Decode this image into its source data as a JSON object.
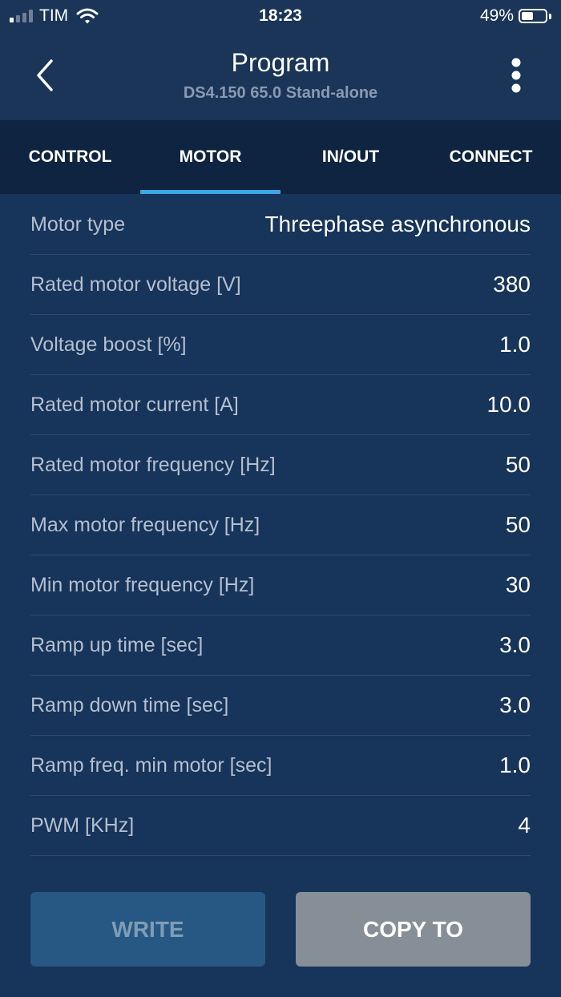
{
  "status_bar": {
    "carrier": "TIM",
    "time": "18:23",
    "battery": "49%",
    "battery_level": 0.49,
    "signal_bars_active": 1,
    "signal_bars_total": 4
  },
  "header": {
    "title": "Program",
    "subtitle": "DS4.150 65.0 Stand-alone",
    "back_icon": "chevron-left-icon",
    "menu_icon": "more-vertical-icon"
  },
  "tabs": [
    {
      "label": "CONTROL",
      "active": false
    },
    {
      "label": "MOTOR",
      "active": true
    },
    {
      "label": "IN/OUT",
      "active": false
    },
    {
      "label": "CONNECT",
      "active": false
    }
  ],
  "parameters": [
    {
      "label": "Motor type",
      "value": "Threephase asynchronous"
    },
    {
      "label": "Rated motor voltage [V]",
      "value": "380"
    },
    {
      "label": "Voltage boost [%]",
      "value": "1.0"
    },
    {
      "label": "Rated motor current [A]",
      "value": "10.0"
    },
    {
      "label": "Rated motor frequency [Hz]",
      "value": "50"
    },
    {
      "label": "Max motor frequency [Hz]",
      "value": "50"
    },
    {
      "label": "Min motor frequency [Hz]",
      "value": "30"
    },
    {
      "label": "Ramp up time [sec]",
      "value": "3.0"
    },
    {
      "label": "Ramp down time [sec]",
      "value": "3.0"
    },
    {
      "label": "Ramp freq. min motor [sec]",
      "value": "1.0"
    },
    {
      "label": "PWM [KHz]",
      "value": "4"
    }
  ],
  "actions": {
    "write_label": "WRITE",
    "copy_label": "COPY TO"
  },
  "colors": {
    "header_bg": "#1a3558",
    "tab_bar_bg": "#0e2440",
    "active_tab_indicator": "#3da7df",
    "content_bg": "#17345a",
    "write_button_bg": "#275883",
    "copy_button_bg": "#868f98"
  }
}
